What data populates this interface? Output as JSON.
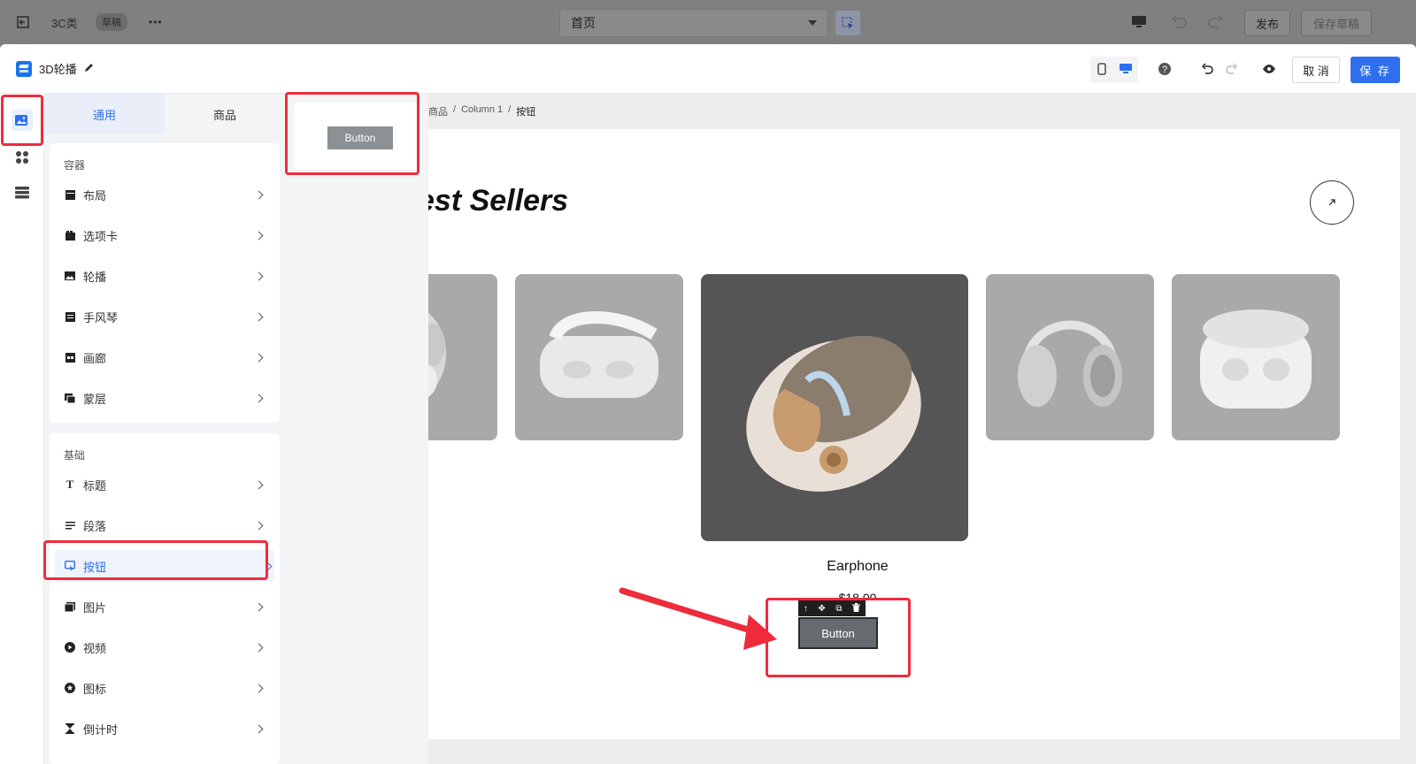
{
  "topbar": {
    "project": "3C类",
    "status_badge": "草稿",
    "more": "•••",
    "page_select": "首页",
    "publish": "发布",
    "save_draft": "保存草稿"
  },
  "editor": {
    "title": "3D轮播",
    "cancel": "取 消",
    "save": "保 存"
  },
  "panel": {
    "tabs": [
      "通用",
      "商品"
    ],
    "group_container": {
      "title": "容器",
      "items": [
        "布局",
        "选项卡",
        "轮播",
        "手风琴",
        "画廊",
        "蒙层"
      ]
    },
    "group_basic": {
      "title": "基础",
      "items": [
        "标题",
        "段落",
        "按钮",
        "图片",
        "视频",
        "图标",
        "倒计时"
      ]
    }
  },
  "preview": {
    "button_label": "Button"
  },
  "canvas": {
    "breadcrumb": [
      "商品",
      "/",
      "Column 1",
      "/",
      "按钮"
    ],
    "headline": "est Sellers",
    "product_name": "Earphone",
    "price": "$18.00",
    "button_label": "Button"
  },
  "colors": {
    "accent": "#2f6fed",
    "annotation": "#ee2c3c",
    "slide_bg": "#a9a9a9",
    "slide_active_bg": "#555555"
  }
}
